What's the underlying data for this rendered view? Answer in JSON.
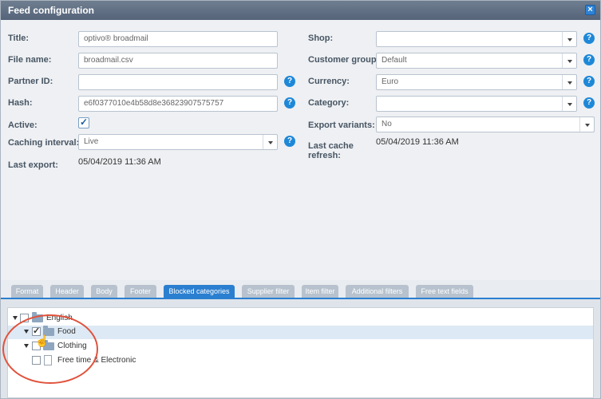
{
  "window": {
    "title": "Feed configuration",
    "close_icon": "close-icon"
  },
  "form": {
    "title": {
      "label": "Title:",
      "value": "optivo® broadmail"
    },
    "file_name": {
      "label": "File name:",
      "value": "broadmail.csv"
    },
    "partner_id": {
      "label": "Partner ID:",
      "value": ""
    },
    "hash": {
      "label": "Hash:",
      "value": "e6f0377010e4b58d8e36823907575757"
    },
    "active": {
      "label": "Active:",
      "checked": true
    },
    "caching_interval": {
      "label": "Caching interval:",
      "value": "Live"
    },
    "last_export": {
      "label": "Last export:",
      "value": "05/04/2019 11:36 AM"
    },
    "shop": {
      "label": "Shop:",
      "value": ""
    },
    "customer_group": {
      "label": "Customer group:",
      "value": "Default"
    },
    "currency": {
      "label": "Currency:",
      "value": "Euro"
    },
    "category": {
      "label": "Category:",
      "value": ""
    },
    "export_variants": {
      "label": "Export variants:",
      "value": "No"
    },
    "last_cache_refresh": {
      "label": "Last cache refresh:",
      "value": "05/04/2019 11:36 AM"
    },
    "help_glyph": "?"
  },
  "tabs": [
    {
      "label": "Format",
      "active": false
    },
    {
      "label": "Header",
      "active": false
    },
    {
      "label": "Body",
      "active": false
    },
    {
      "label": "Footer",
      "active": false
    },
    {
      "label": "Blocked categories",
      "active": true
    },
    {
      "label": "Supplier filter",
      "active": false
    },
    {
      "label": "Item filter",
      "active": false
    },
    {
      "label": "Additional filters",
      "active": false
    },
    {
      "label": "Free text fields",
      "active": false
    }
  ],
  "tree": [
    {
      "label": "English",
      "level": 0,
      "expanded": true,
      "checked": false,
      "type": "folder"
    },
    {
      "label": "Food",
      "level": 1,
      "expanded": true,
      "checked": true,
      "type": "folder"
    },
    {
      "label": "Clothing",
      "level": 1,
      "expanded": true,
      "checked": false,
      "type": "folder"
    },
    {
      "label": "Free time & Electronic",
      "level": 1,
      "expanded": false,
      "checked": false,
      "type": "document"
    }
  ],
  "colors": {
    "accent": "#2b7fd0",
    "annotation": "#e0523c",
    "tab_inactive": "#b7c2ce"
  }
}
